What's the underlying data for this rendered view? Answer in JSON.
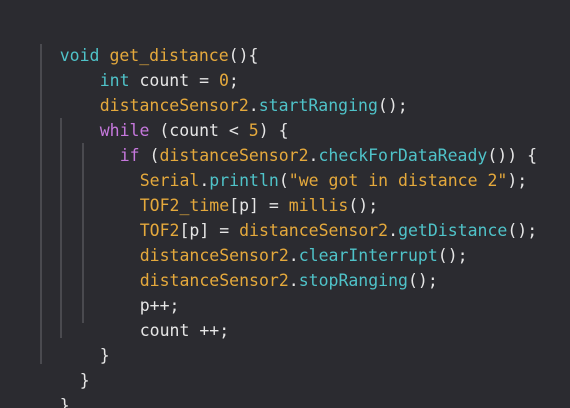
{
  "code": {
    "line1": {
      "kw": "void",
      "fn": "get_distance",
      "rest": "(){"
    },
    "line2": {
      "kw": "int",
      "rest1": " count = ",
      "num": "0",
      "rest2": ";"
    },
    "line3": {
      "obj": "distanceSensor2",
      "dot": ".",
      "meth": "startRanging",
      "rest": "();"
    },
    "line4": {
      "kw": "while",
      "rest1": " (count < ",
      "num": "5",
      "rest2": ") {"
    },
    "line5": {
      "kw": "if",
      "rest1": " (",
      "obj": "distanceSensor2",
      "dot": ".",
      "meth": "checkForDataReady",
      "rest2": "()) {"
    },
    "line6": {
      "obj": "Serial",
      "dot": ".",
      "meth": "println",
      "rest1": "(",
      "str": "\"we got in distance 2\"",
      "rest2": ");"
    },
    "line7": {
      "obj": "TOF2_time",
      "rest1": "[p] = ",
      "fn": "millis",
      "rest2": "();"
    },
    "line8": {
      "obj": "TOF2",
      "rest1": "[p] = ",
      "obj2": "distanceSensor2",
      "dot": ".",
      "meth": "getDistance",
      "rest2": "();"
    },
    "line9": {
      "obj": "distanceSensor2",
      "dot": ".",
      "meth": "clearInterrupt",
      "rest": "();"
    },
    "line10": {
      "obj": "distanceSensor2",
      "dot": ".",
      "meth": "stopRanging",
      "rest": "();"
    },
    "line11": {
      "text": "p++;"
    },
    "line12": {
      "text": "count ++;"
    },
    "line13": {
      "text": "}"
    },
    "line14": {
      "text": "}"
    },
    "line15": {
      "text": "}"
    }
  }
}
